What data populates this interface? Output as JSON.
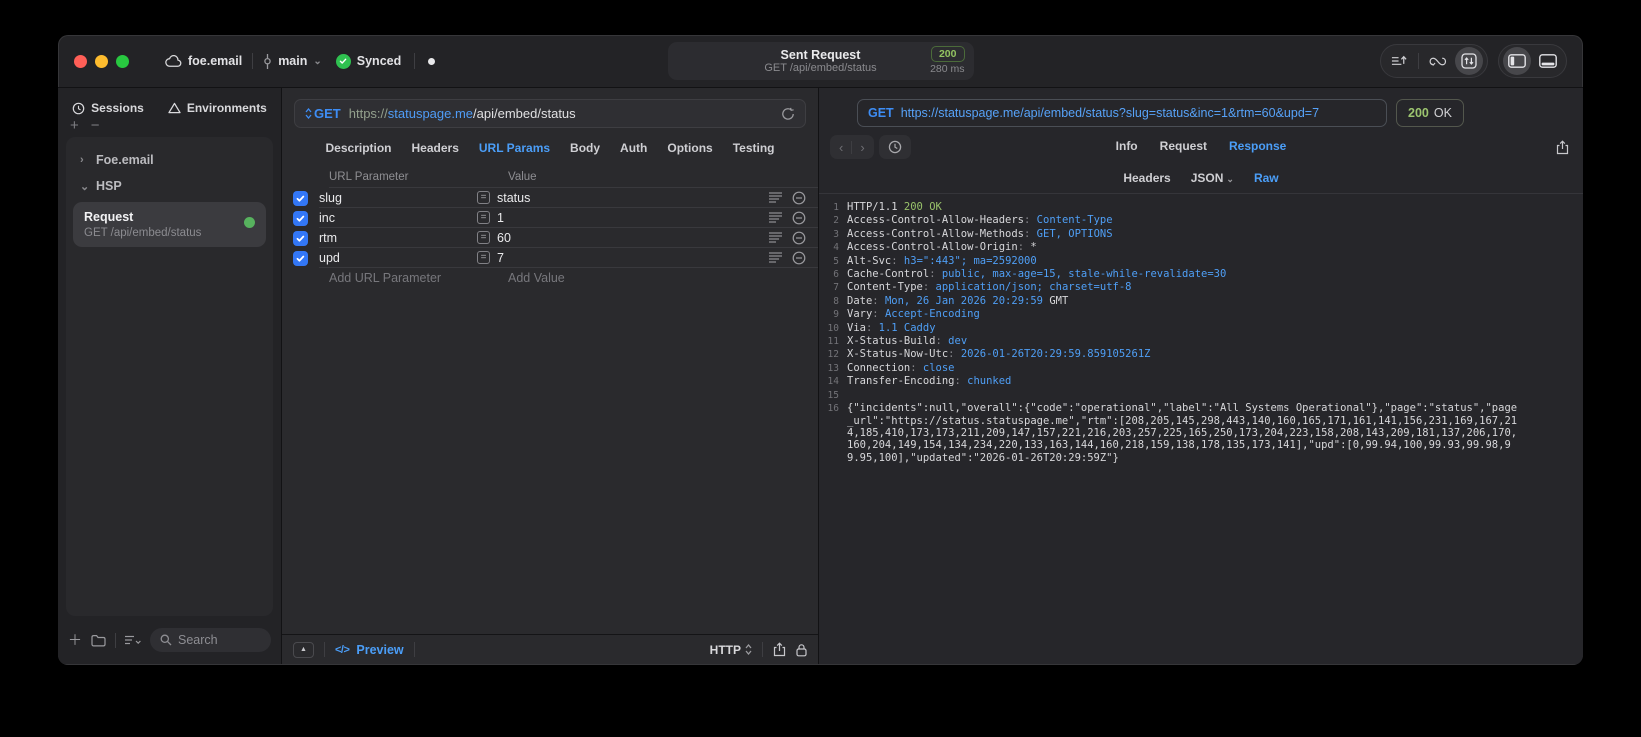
{
  "colors": {
    "accent_blue": "#4b9ef8",
    "method_blue": "#3d8df5",
    "status_green": "#98c26a",
    "checkbox_blue": "#3377f6",
    "sync_green": "#2fc150"
  },
  "titlebar": {
    "workspace": "foe.email",
    "branch": "main",
    "sync_label": "Synced",
    "center": {
      "title": "Sent Request",
      "subtitle": "GET /api/embed/status",
      "status_code": "200",
      "duration": "280 ms"
    }
  },
  "sidebar": {
    "tabs": [
      {
        "label": "Sessions"
      },
      {
        "label": "Environments"
      }
    ],
    "tree": {
      "group1": "Foe.email",
      "group2": "HSP",
      "request": {
        "title": "Request",
        "subtitle": "GET /api/embed/status"
      }
    },
    "search_placeholder": "Search"
  },
  "editor": {
    "method": "GET",
    "url": {
      "scheme": "https://",
      "host": "statuspage.me",
      "path": "/api/embed/status"
    },
    "tabs": [
      "Description",
      "Headers",
      "URL Params",
      "Body",
      "Auth",
      "Options",
      "Testing"
    ],
    "active_tab": "URL Params",
    "table": {
      "columns": [
        "URL Parameter",
        "Value"
      ],
      "rows": [
        {
          "name": "slug",
          "value": "status",
          "checked": true
        },
        {
          "name": "inc",
          "value": "1",
          "checked": true
        },
        {
          "name": "rtm",
          "value": "60",
          "checked": true
        },
        {
          "name": "upd",
          "value": "7",
          "checked": true
        }
      ],
      "add_row": {
        "name_placeholder": "Add URL Parameter",
        "value_placeholder": "Add Value"
      }
    },
    "footer": {
      "preview": "Preview",
      "code_glyph": "</>",
      "protocol": "HTTP"
    }
  },
  "response": {
    "method": "GET",
    "url": "https://statuspage.me/api/embed/status?slug=status&inc=1&rtm=60&upd=7",
    "status_code": "200",
    "status_text": "OK",
    "tabs": [
      "Info",
      "Request",
      "Response"
    ],
    "active_tab": "Response",
    "subtabs": [
      "Headers",
      "JSON",
      "Raw"
    ],
    "active_subtab": "Raw",
    "code_lines": [
      {
        "n": "1",
        "parts": [
          [
            "p",
            "HTTP/1.1 "
          ],
          [
            "g",
            "200 OK"
          ]
        ]
      },
      {
        "n": "2",
        "parts": [
          [
            "k",
            "Access-Control-Allow-Headers"
          ],
          [
            "d",
            ": "
          ],
          [
            "v",
            "Content-Type"
          ]
        ]
      },
      {
        "n": "3",
        "parts": [
          [
            "k",
            "Access-Control-Allow-Methods"
          ],
          [
            "d",
            ": "
          ],
          [
            "v",
            "GET, OPTIONS"
          ]
        ]
      },
      {
        "n": "4",
        "parts": [
          [
            "k",
            "Access-Control-Allow-Origin"
          ],
          [
            "d",
            ": "
          ],
          [
            "p",
            "*"
          ]
        ]
      },
      {
        "n": "5",
        "parts": [
          [
            "k",
            "Alt-Svc"
          ],
          [
            "d",
            ": "
          ],
          [
            "v",
            "h3=\":443\"; ma=2592000"
          ]
        ]
      },
      {
        "n": "6",
        "parts": [
          [
            "k",
            "Cache-Control"
          ],
          [
            "d",
            ": "
          ],
          [
            "v",
            "public, max-age=15, stale-while-revalidate=30"
          ]
        ]
      },
      {
        "n": "7",
        "parts": [
          [
            "k",
            "Content-Type"
          ],
          [
            "d",
            ": "
          ],
          [
            "v",
            "application/json; charset=utf-8"
          ]
        ]
      },
      {
        "n": "8",
        "parts": [
          [
            "k",
            "Date"
          ],
          [
            "d",
            ": "
          ],
          [
            "v",
            "Mon, 26 Jan 2026 20:29:59"
          ],
          [
            "p",
            " GMT"
          ]
        ]
      },
      {
        "n": "9",
        "parts": [
          [
            "k",
            "Vary"
          ],
          [
            "d",
            ": "
          ],
          [
            "v",
            "Accept-Encoding"
          ]
        ]
      },
      {
        "n": "10",
        "parts": [
          [
            "k",
            "Via"
          ],
          [
            "d",
            ": "
          ],
          [
            "v",
            "1.1 Caddy"
          ]
        ]
      },
      {
        "n": "11",
        "parts": [
          [
            "k",
            "X-Status-Build"
          ],
          [
            "d",
            ": "
          ],
          [
            "v",
            "dev"
          ]
        ]
      },
      {
        "n": "12",
        "parts": [
          [
            "k",
            "X-Status-Now-Utc"
          ],
          [
            "d",
            ": "
          ],
          [
            "v",
            "2026-01-26T20:29:59.859105261Z"
          ]
        ]
      },
      {
        "n": "13",
        "parts": [
          [
            "k",
            "Connection"
          ],
          [
            "d",
            ": "
          ],
          [
            "v",
            "close"
          ]
        ]
      },
      {
        "n": "14",
        "parts": [
          [
            "k",
            "Transfer-Encoding"
          ],
          [
            "d",
            ": "
          ],
          [
            "v",
            "chunked"
          ]
        ]
      },
      {
        "n": "15",
        "parts": []
      },
      {
        "n": "16",
        "parts": [
          [
            "p",
            "{\"incidents\":null,\"overall\":{\"code\":\"operational\",\"label\":\"All Systems Operational\"},\"page\":\"status\",\"page_url\":\"https://status.statuspage.me\",\"rtm\":[208,205,145,298,443,140,160,165,171,161,141,156,231,169,167,214,185,410,173,173,211,209,147,157,221,216,203,257,225,165,250,173,204,223,158,208,143,209,181,137,206,170,160,204,149,154,134,234,220,133,163,144,160,218,159,138,178,135,173,141],\"upd\":[0,99.94,100,99.93,99.98,99.95,100],\"updated\":\"2026-01-26T20:29:59Z\"}"
          ]
        ]
      }
    ]
  }
}
